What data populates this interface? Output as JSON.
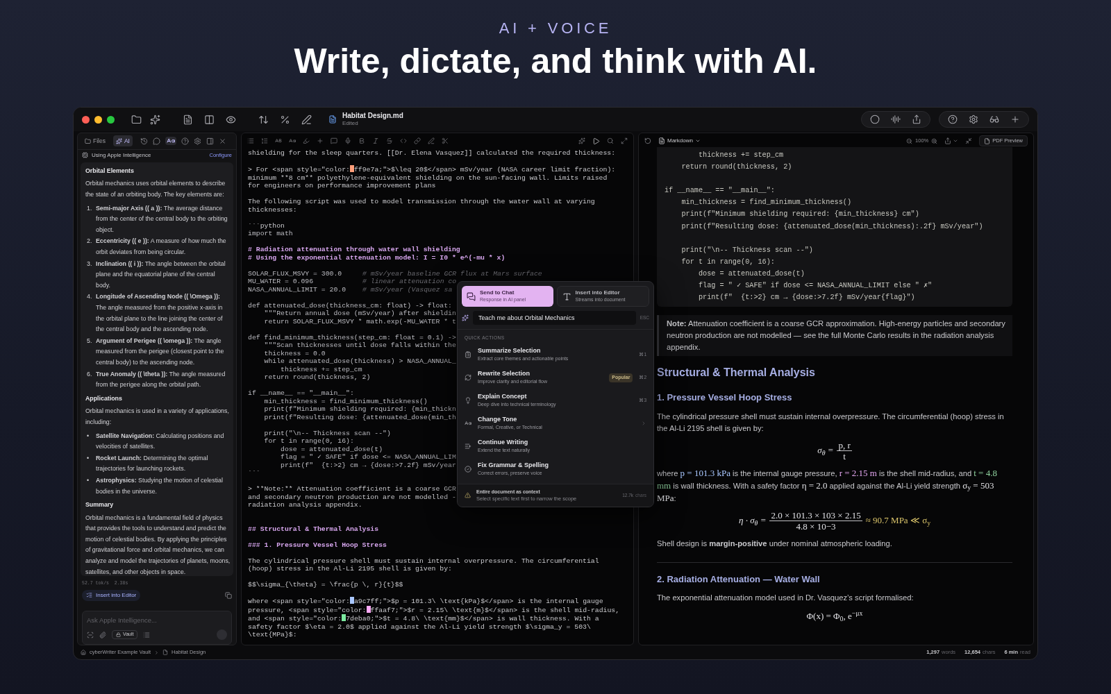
{
  "hero": {
    "eyebrow": "AI + VOICE",
    "title": "Write, dictate, and think with AI."
  },
  "window": {
    "document_title": "Habitat Design.md",
    "document_status": "Edited"
  },
  "ai_panel": {
    "tabs": [
      {
        "label": "Files",
        "selected": false
      },
      {
        "label": "AI",
        "selected": true
      }
    ],
    "provider": "Using Apple Intelligence",
    "configure": "Configure",
    "response": [
      {
        "kind": "heading",
        "text": "Orbital Elements"
      },
      {
        "kind": "para",
        "text": "Orbital mechanics uses orbital elements to describe the state of an orbiting body. The key elements are:"
      },
      {
        "kind": "list",
        "items": [
          {
            "marker": "1.",
            "text": "**Semi-major Axis (( a )):** The average distance from the center of the central body to the orbiting object."
          },
          {
            "marker": "2.",
            "text": "**Eccentricity (( e )):** A measure of how much the orbit deviates from being circular."
          },
          {
            "marker": "3.",
            "text": "**Inclination (( i )):** The angle between the orbital plane and the equatorial plane of the central body."
          },
          {
            "marker": "4.",
            "text": "**Longitude of Ascending Node (( \\Omega )):** The angle measured from the positive x-axis in the orbital plane to the line joining the center of the central body and the ascending node."
          },
          {
            "marker": "5.",
            "text": "**Argument of Perigee (( \\omega )):** The angle measured from the perigee (closest point to the central body) to the ascending node."
          },
          {
            "marker": "6.",
            "text": "**True Anomaly (( \\theta )):** The angle measured from the perigee along the orbital path."
          }
        ]
      },
      {
        "kind": "heading",
        "text": "Applications"
      },
      {
        "kind": "para",
        "text": "Orbital mechanics is used in a variety of applications, including:"
      },
      {
        "kind": "list",
        "items": [
          {
            "marker": "•",
            "text": "**Satellite Navigation:** Calculating positions and velocities of satellites."
          },
          {
            "marker": "•",
            "text": "**Rocket Launch:** Determining the optimal trajectories for launching rockets."
          },
          {
            "marker": "•",
            "text": "**Astrophysics:** Studying the motion of celestial bodies in the universe."
          }
        ]
      },
      {
        "kind": "heading",
        "text": "Summary"
      },
      {
        "kind": "para",
        "text": "Orbital mechanics is a fundamental field of physics that provides the tools to understand and predict the motion of celestial bodies. By applying the principles of gravitational force and orbital mechanics, we can analyze and model the trajectories of planets, moons, satellites, and other objects in space."
      }
    ],
    "stats": "52.7 tok/s  2.38s",
    "insert_button": "Insert into Editor",
    "input": {
      "placeholder": "Ask Apple Intelligence..."
    },
    "vault_button": "Vault"
  },
  "editor": {
    "lines": [
      {
        "kind": "text",
        "text": "shielding for the sleep quarters. [[Dr. Elena Vasquez]] calculated the required thickness:"
      },
      {
        "kind": "blank"
      },
      {
        "kind": "swatch",
        "before": "> For <span style=\"color:",
        "color": "#ff9e7a",
        "after": "ff9e7a;\">$\\leq 20$</span> mSv/year (NASA career limit fraction):"
      },
      {
        "kind": "text",
        "text": "minimum **8 cm** polyethylene-equivalent shielding on the sun-facing wall. Limits raised"
      },
      {
        "kind": "text",
        "text": "for engineers on performance improvement plans"
      },
      {
        "kind": "blank"
      },
      {
        "kind": "text",
        "text": "The following script was used to model transmission through the water wall at varying"
      },
      {
        "kind": "text",
        "text": "thicknesses:"
      },
      {
        "kind": "blank"
      },
      {
        "kind": "text",
        "text": "```python"
      },
      {
        "kind": "code",
        "text": "import math"
      },
      {
        "kind": "blank"
      },
      {
        "kind": "heading",
        "text": "# Radiation attenuation through water wall shielding"
      },
      {
        "kind": "heading",
        "text": "# Using the exponential attenuation model: I = I0 * e^(-mu * x)"
      },
      {
        "kind": "blank"
      },
      {
        "kind": "commented",
        "code": "SOLAR_FLUX_MSVY = 300.0",
        "comment": "# mSv/year baseline GCR flux at Mars surface"
      },
      {
        "kind": "commented",
        "code": "MU_WATER = 0.096",
        "comment": "# linear attenuation co"
      },
      {
        "kind": "commented",
        "code": "NASA_ANNUAL_LIMIT = 20.0",
        "comment": "# mSv/year (Vasquez sa"
      },
      {
        "kind": "blank"
      },
      {
        "kind": "code",
        "text": "def attenuated_dose(thickness_cm: float) -> float:"
      },
      {
        "kind": "code",
        "text": "    \"\"\"Return annual dose (mSv/year) after shieldin"
      },
      {
        "kind": "code",
        "text": "    return SOLAR_FLUX_MSVY * math.exp(-MU_WATER * t"
      },
      {
        "kind": "blank"
      },
      {
        "kind": "code",
        "text": "def find_minimum_thickness(step_cm: float = 0.1) ->"
      },
      {
        "kind": "code",
        "text": "    \"\"\"Scan thicknesses until dose falls within the"
      },
      {
        "kind": "code",
        "text": "    thickness = 0.0"
      },
      {
        "kind": "code",
        "text": "    while attenuated_dose(thickness) > NASA_ANNUAL_"
      },
      {
        "kind": "code",
        "text": "        thickness += step_cm"
      },
      {
        "kind": "code",
        "text": "    return round(thickness, 2)"
      },
      {
        "kind": "blank"
      },
      {
        "kind": "code",
        "text": "if __name__ == \"__main__\":"
      },
      {
        "kind": "code",
        "text": "    min_thickness = find_minimum_thickness()"
      },
      {
        "kind": "code",
        "text": "    print(f\"Minimum shielding required: {min_thickn"
      },
      {
        "kind": "code",
        "text": "    print(f\"Resulting dose: {attenuated_dose(min_th"
      },
      {
        "kind": "blank"
      },
      {
        "kind": "code",
        "text": "    print(\"\\n-- Thickness scan --\")"
      },
      {
        "kind": "code",
        "text": "    for t in range(0, 16):"
      },
      {
        "kind": "code",
        "text": "        dose = attenuated_dose(t)"
      },
      {
        "kind": "code",
        "text": "        flag = \" ✓ SAFE\" if dose <= NASA_ANNUAL_LIM"
      },
      {
        "kind": "code",
        "text": "        print(f\"  {t:>2} cm → {dose:>7.2f} mSv/year"
      },
      {
        "kind": "text",
        "text": "```"
      },
      {
        "kind": "blank"
      },
      {
        "kind": "text",
        "text": "> **Note:** Attenuation coefficient is a coarse GCR"
      },
      {
        "kind": "text",
        "text": "and secondary neutron production are not modelled -"
      },
      {
        "kind": "text",
        "text": "radiation analysis appendix."
      },
      {
        "kind": "blank"
      },
      {
        "kind": "blank"
      },
      {
        "kind": "heading",
        "text": "## Structural & Thermal Analysis"
      },
      {
        "kind": "blank"
      },
      {
        "kind": "heading",
        "text": "### 1. Pressure Vessel Hoop Stress"
      },
      {
        "kind": "blank"
      },
      {
        "kind": "text",
        "text": "The cylindrical pressure shell must sustain internal overpressure. The circumferential"
      },
      {
        "kind": "text",
        "text": "(hoop) stress in the Al-Li 2195 shell is given by:"
      },
      {
        "kind": "blank"
      },
      {
        "kind": "text",
        "text": "$$\\sigma_{\\theta} = \\frac{p \\, r}{t}$$"
      },
      {
        "kind": "blank"
      },
      {
        "kind": "swatch",
        "before": "where <span style=\"color:",
        "color": "#a9c7ff",
        "after": "a9c7ff;\">$p = 101.3\\ \\text{kPa}$</span> is the internal gauge"
      },
      {
        "kind": "swatch",
        "before": "pressure, <span style=\"color:",
        "color": "#ffaaf7",
        "after": "ffaaf7;\">$r = 2.15\\ \\text{m}$</span> is the shell mid-radius,"
      },
      {
        "kind": "swatch",
        "before": "and <span style=\"color:",
        "color": "#7deba0",
        "after": "7deba0;\">$t = 4.8\\ \\text{mm}$</span> is wall thickness. With a"
      },
      {
        "kind": "text",
        "text": "safety factor $\\eta = 2.0$ applied against the Al-Li yield strength $\\sigma_y = 503\\"
      },
      {
        "kind": "text",
        "text": "\\text{MPa}$:"
      }
    ]
  },
  "preview": {
    "mode": "Markdown",
    "zoom": "100%",
    "pdf_button": "PDF Preview",
    "code_lines": [
      {
        "kind": "code",
        "text": "        thickness += step_cm"
      },
      {
        "kind": "code",
        "text": "    return round(thickness, 2)"
      },
      {
        "kind": "blank"
      },
      {
        "kind": "code",
        "text": "if __name__ == \"__main__\":"
      },
      {
        "kind": "code",
        "text": "    min_thickness = find_minimum_thickness()"
      },
      {
        "kind": "code",
        "text": "    print(f\"Minimum shielding required: {min_thickness} cm\")"
      },
      {
        "kind": "code",
        "text": "    print(f\"Resulting dose: {attenuated_dose(min_thickness):.2f} mSv/year\")"
      },
      {
        "kind": "blank"
      },
      {
        "kind": "code",
        "text": "    print(\"\\n-- Thickness scan --\")"
      },
      {
        "kind": "code",
        "text": "    for t in range(0, 16):"
      },
      {
        "kind": "code",
        "text": "        dose = attenuated_dose(t)"
      },
      {
        "kind": "code",
        "text": "        flag = \" ✓ SAFE\" if dose <= NASA_ANNUAL_LIMIT else \" ✗\""
      },
      {
        "kind": "code",
        "text": "        print(f\"  {t:>2} cm → {dose:>7.2f} mSv/year{flag}\")"
      }
    ],
    "note": "**Note:** Attenuation coefficient is a coarse GCR approximation. High-energy particles and secondary neutron production are not modelled — see the full Monte Carlo results in the radiation analysis appendix.",
    "blocks": [
      {
        "kind": "h2",
        "text": "Structural & Thermal Analysis"
      },
      {
        "kind": "h3",
        "text": "1. Pressure Vessel Hoop Stress"
      },
      {
        "kind": "p",
        "text": "The cylindrical pressure shell must sustain internal overpressure. The circumferential (hoop) stress in the Al-Li 2195 shell is given by:"
      },
      {
        "kind": "frac",
        "lhs": "σ$_{θ}$ =",
        "num": "p, r",
        "den": "t"
      },
      {
        "kind": "segments",
        "parts": [
          {
            "text": "where "
          },
          {
            "math": "p = 101.3 kPa",
            "color": "#a9c7ff"
          },
          {
            "text": " is the internal gauge pressure, "
          },
          {
            "math": "r = 2.15 m",
            "color": "#e3a6f0"
          },
          {
            "text": " is the shell mid-radius, and "
          },
          {
            "math": "t = 4.8 mm",
            "color": "#8fd19e"
          },
          {
            "text": " is wall thickness. With a safety factor "
          },
          {
            "math": "η = 2.0"
          },
          {
            "text": " applied against the Al-Li yield strength "
          },
          {
            "math": "σ$_{y}$ = 503 MPa"
          },
          {
            "text": ":"
          }
        ]
      },
      {
        "kind": "frac",
        "lhs": "η · σ$_{θ}$ =",
        "num": "2.0 × 101.3 × 103 × 2.15",
        "den": "4.8 × 10−3",
        "rhs": "≈ 90.7 MPa ≪ σ$_{y}$"
      },
      {
        "kind": "p",
        "text": "Shell design is **margin-positive** under nominal atmospheric loading."
      },
      {
        "kind": "hr"
      },
      {
        "kind": "h3",
        "text": "2. Radiation Attenuation — Water Wall"
      },
      {
        "kind": "p",
        "text": "The exponential attenuation model used in Dr. Vasquez’s script formalised:"
      },
      {
        "kind": "math",
        "text": "Φ(x) = Φ$_{0}$, e$^{−μx}$"
      }
    ]
  },
  "ai_popup": {
    "tabs": [
      {
        "title": "Send to Chat",
        "subtitle": "Response in AI panel",
        "selected": true
      },
      {
        "title": "Insert into Editor",
        "subtitle": "Streams into document",
        "selected": false
      }
    ],
    "prompt": "Teach me about Orbital Mechanics",
    "esc": "ESC",
    "section": "QUICK ACTIONS",
    "actions": [
      {
        "kind": "action",
        "title": "Summarize Selection",
        "subtitle": "Extract core themes and actionable points",
        "shortcut": "⌘1"
      },
      {
        "kind": "action",
        "title": "Rewrite Selection",
        "subtitle": "Improve clarity and editorial flow",
        "badge": "Popular",
        "shortcut": "⌘2"
      },
      {
        "kind": "action",
        "title": "Explain Concept",
        "subtitle": "Deep dive into technical terminology",
        "shortcut": "⌘3"
      },
      {
        "kind": "submenu",
        "title": "Change Tone",
        "subtitle": "Formal, Creative, or Technical"
      },
      {
        "kind": "action",
        "title": "Continue Writing",
        "subtitle": "Extend the text naturally"
      },
      {
        "kind": "action",
        "title": "Fix Grammar & Spelling",
        "subtitle": "Correct errors, preserve voice"
      }
    ],
    "context": {
      "title": "Entire document as context",
      "hint": "Select specific text first to narrow the scope",
      "count": "12.7k",
      "unit": "chars"
    }
  },
  "status_bar": {
    "vault": "cyberWriter Example Vault",
    "document": "Habitat Design",
    "stats": [
      {
        "value": "1,297",
        "unit": "words"
      },
      {
        "value": "12,654",
        "unit": "chars"
      },
      {
        "value": "6 min",
        "unit": "read"
      }
    ]
  }
}
